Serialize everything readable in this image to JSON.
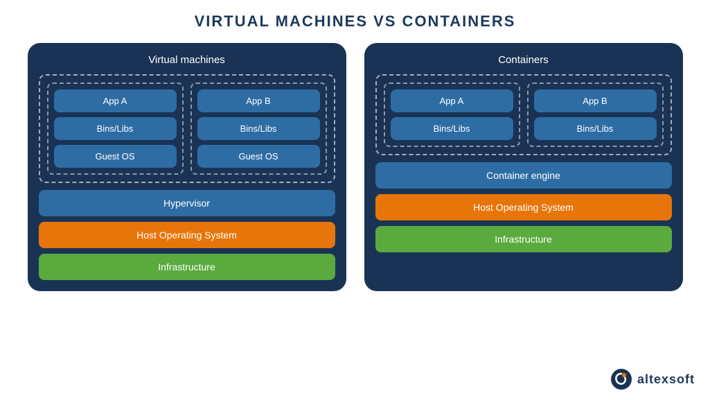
{
  "page": {
    "title": "VIRTUAL MACHINES VS CONTAINERS"
  },
  "vm_diagram": {
    "title": "Virtual machines",
    "col1": {
      "app": "App A",
      "bins": "Bins/Libs",
      "guest_os": "Guest OS"
    },
    "col2": {
      "app": "App B",
      "bins": "Bins/Libs",
      "guest_os": "Guest OS"
    },
    "hypervisor": "Hypervisor",
    "host_os": "Host Operating System",
    "infra": "Infrastructure"
  },
  "containers_diagram": {
    "title": "Containers",
    "col1": {
      "app": "App A",
      "bins": "Bins/Libs"
    },
    "col2": {
      "app": "App B",
      "bins": "Bins/Libs"
    },
    "engine": "Container engine",
    "host_os": "Host Operating System",
    "infra": "Infrastructure"
  },
  "logo": {
    "text": "altexsoft"
  }
}
